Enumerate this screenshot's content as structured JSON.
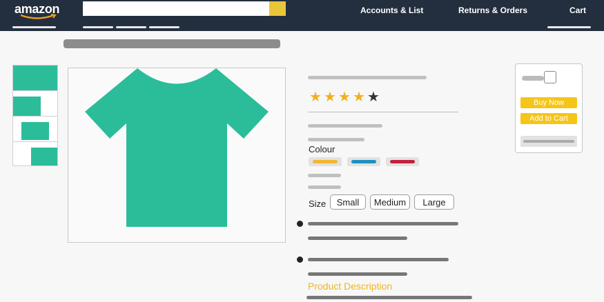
{
  "header": {
    "logo": "amazon",
    "nav": {
      "accounts": "Accounts & List",
      "returns": "Returns & Orders",
      "cart": "Cart"
    }
  },
  "product": {
    "rating": 4,
    "rating_max": 5,
    "colour_label": "Colour",
    "colours": [
      "#f2b632",
      "#1f8fbf",
      "#c0213d"
    ],
    "size_label": "Size",
    "sizes": [
      "Small",
      "Medium",
      "Large"
    ],
    "description_heading": "Product Description"
  },
  "buybox": {
    "buy_now": "Buy Now",
    "add_to_cart": "Add to Cart"
  },
  "colors": {
    "brand_dark": "#232f3e",
    "accent_yellow": "#f5c518",
    "product_teal": "#2bbd9a",
    "description_text": "#f0b41f"
  }
}
